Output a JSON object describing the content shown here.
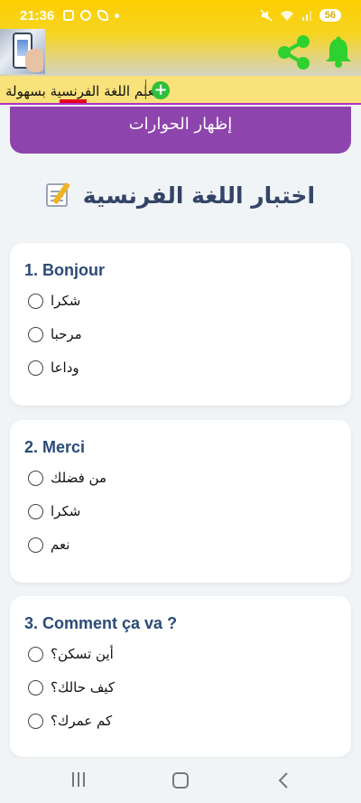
{
  "status_bar": {
    "time": "21:36",
    "battery": "56"
  },
  "app_bar": {
    "label_text": "تعلم اللغة الفرنسية بسهولة",
    "add_symbol": "+"
  },
  "dialogs_button": {
    "label": "إظهار الحوارات"
  },
  "page": {
    "title": "اختبار اللغة الفرنسية"
  },
  "questions": [
    {
      "title": "1. Bonjour",
      "options": [
        "شكرا",
        "مرحبا",
        "وداعا"
      ]
    },
    {
      "title": "2. Merci",
      "options": [
        "من فضلك",
        "شكرا",
        "نعم"
      ]
    },
    {
      "title": "3. Comment ça va ?",
      "options": [
        "أين تسكن؟",
        "كيف حالك؟",
        "كم عمرك؟"
      ]
    }
  ],
  "colors": {
    "accent_purple": "#8e44ad",
    "topbar_yellow": "#fdcf00",
    "icon_green": "#2fd12f",
    "question_blue": "#2b4a78"
  },
  "icons": [
    "share-icon",
    "bell-icon",
    "add-icon",
    "memo-icon",
    "recent-apps-icon",
    "home-icon",
    "back-icon"
  ]
}
